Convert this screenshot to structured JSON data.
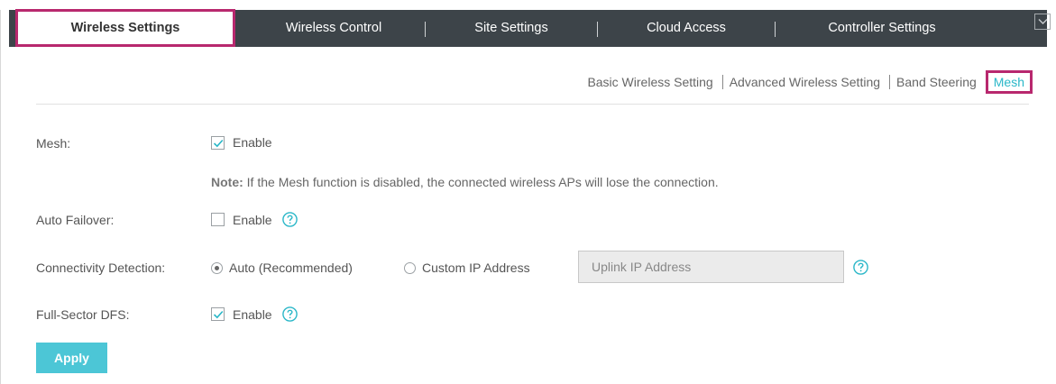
{
  "tabs": [
    {
      "label": "Wireless Settings",
      "active": true
    },
    {
      "label": "Wireless Control",
      "active": false
    },
    {
      "label": "Site Settings",
      "active": false
    },
    {
      "label": "Cloud Access",
      "active": false
    },
    {
      "label": "Controller Settings",
      "active": false
    }
  ],
  "subtabs": [
    {
      "label": "Basic Wireless Setting"
    },
    {
      "label": "Advanced Wireless Setting"
    },
    {
      "label": "Band Steering"
    },
    {
      "label": "Mesh",
      "active": true
    }
  ],
  "form": {
    "mesh": {
      "label": "Mesh:",
      "checkbox_label": "Enable",
      "checked": true
    },
    "note": {
      "prefix": "Note:",
      "text": " If the Mesh function is disabled, the connected wireless APs will lose the connection."
    },
    "auto_failover": {
      "label": "Auto Failover:",
      "checkbox_label": "Enable",
      "checked": false
    },
    "connectivity": {
      "label": "Connectivity Detection:",
      "option_auto": "Auto (Recommended)",
      "option_custom": "Custom IP Address",
      "selected": "auto",
      "ip_placeholder": "Uplink IP Address"
    },
    "full_sector_dfs": {
      "label": "Full-Sector DFS:",
      "checkbox_label": "Enable",
      "checked": true
    },
    "apply_label": "Apply"
  },
  "colors": {
    "accent": "#4cc6d6",
    "highlight": "#b8286e",
    "topbar": "#3d4449",
    "help": "#2ab7c8"
  }
}
